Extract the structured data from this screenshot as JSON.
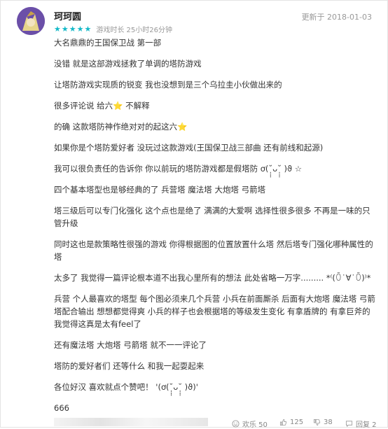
{
  "review": {
    "username": "珂珂圆",
    "updated": "更新于 2018-01-03",
    "star_count": 5,
    "accent_color": "#14b9c8",
    "playtime": "游戏时长 25小时26分钟",
    "paragraphs": [
      "大名鼎鼎的王国保卫战 第一部",
      "没错 就是这部游戏拯救了单调的塔防游戏",
      "让塔防游戏实现质的锐变 我也没想到是三个乌拉圭小伙做出来的",
      "很多评论说 给六⭐ 不解释",
      "的确 这款塔防神作绝对对的起这六⭐",
      "如果你是个塔防爱好者 没玩过这款游戏(王国保卫战三部曲 还有前线和起源)",
      "我可以很负责任的告诉你 你以前玩的塔防游戏都是假塔防 ơ(˘̩̩̩ᴗ˘̩̩̩ )ϑ ☆",
      "四个基本塔型也是够经典的了 兵营塔 魔法塔 大炮塔 弓箭塔",
      "塔三级后可以专门化强化 这个点也是绝了 满满的大爱啊 选择性很多很多 不再是一味的只管升级",
      "同时这也是款策略性很强的游戏 你得根据图的位置放置什么塔 然后塔专门强化哪种属性的塔",
      "太多了 我觉得一篇评论根本道不出我心里所有的想法 此处省略一万字......... *⁽(ꄱ˙∀˙ꄱ)⁾*",
      "兵营 个人最喜欢的塔型 每个图必须来几个兵营 小兵在前面厮杀 后面有大炮塔 魔法塔 弓箭塔配合输出 想想都觉得爽 小兵的样子也会根据塔的等级发生变化 有拿盾牌的 有拿巨斧的 我觉得这真是太有feel了",
      "还有魔法塔 大炮塔 弓箭塔 就不一一评论了",
      "塔防的爱好者们 还等什么 和我一起耍起来",
      "各位好汉 喜欢就点个赞吧！ '(ơ(˘̩̩̩ᴗ˘̩̩̩ )ϑ)'",
      "666"
    ]
  },
  "footer": {
    "like_label": "欢乐 50",
    "upvotes": "125",
    "downvotes": "38",
    "replies": "回复 2"
  }
}
